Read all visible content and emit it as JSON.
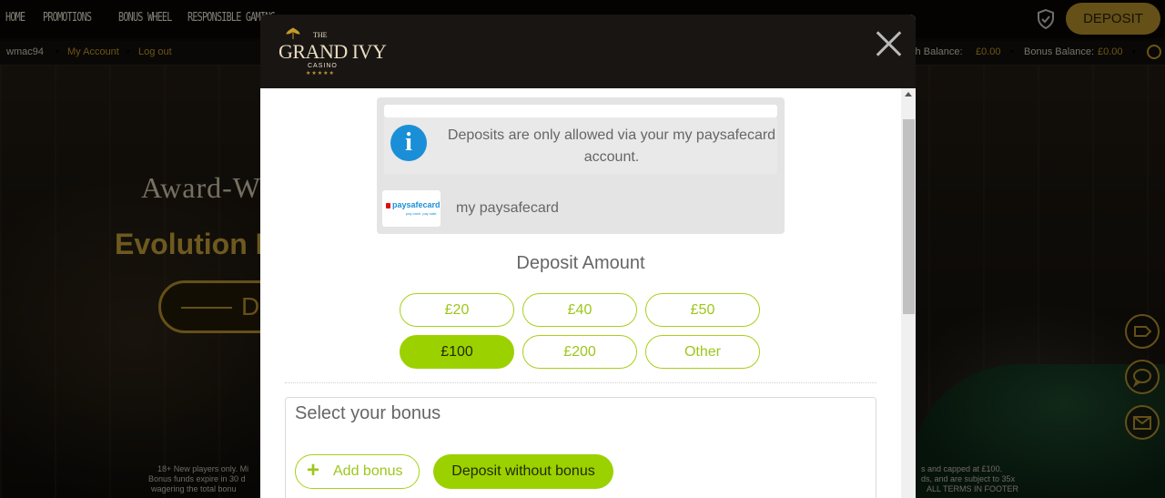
{
  "nav": {
    "links": [
      "HOME",
      "PROMOTIONS",
      "BONUS WHEEL",
      "RESPONSIBLE GAMING"
    ],
    "deposit_label": "DEPOSIT"
  },
  "account": {
    "username": "wmac94",
    "my_account": "My Account",
    "logout": "Log out",
    "cash_balance_label": "Cash Balance:",
    "cash_balance_value": "£0.00",
    "bonus_balance_label": "Bonus Balance:",
    "bonus_balance_value": "£0.00"
  },
  "hero": {
    "title": "Award-Win",
    "subtitle": "Evolution L",
    "button_letter": "D"
  },
  "footer_fine": {
    "left_lines": [
      "18+ New players only. Mi",
      "Bonus funds expire in 30 d",
      "wagering the total bonu"
    ],
    "right_lines": [
      "s and capped at £100.",
      "ds, and are subject to 35x",
      "ALL TERMS IN FOOTER"
    ]
  },
  "modal": {
    "logo": {
      "the": "THE",
      "name": "GRAND IVY",
      "casino": "CASINO",
      "stars": "★★★★★"
    },
    "notice": "Deposits are only allowed via your my paysafecard account.",
    "method": {
      "brand": "paysafecard",
      "tagline": "pay cash. pay safe.",
      "label": "my paysafecard"
    },
    "amount_heading": "Deposit Amount",
    "amounts": [
      "£20",
      "£40",
      "£50",
      "£100",
      "£200",
      "Other"
    ],
    "selected_amount": "£100",
    "bonus": {
      "heading": "Select your bonus",
      "add_label": "Add bonus",
      "add_icon": "+",
      "no_bonus_label": "Deposit without bonus"
    }
  },
  "colors": {
    "accent_green": "#9cd100",
    "gold": "#b8932d",
    "info_blue": "#1a8fd8",
    "modal_header": "#181513"
  }
}
